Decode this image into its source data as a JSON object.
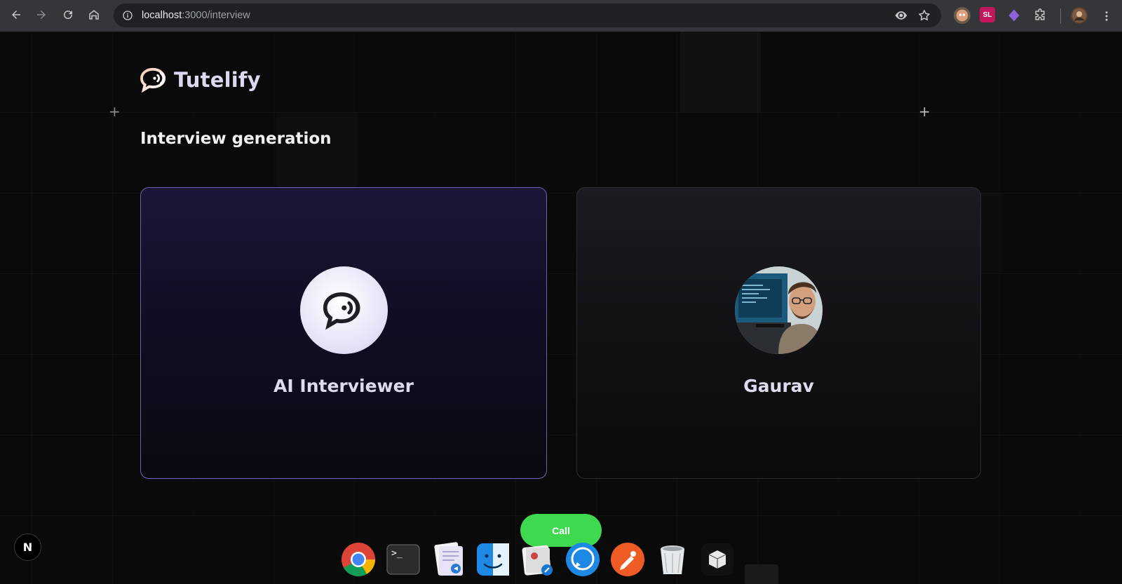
{
  "browser": {
    "url_host": "localhost",
    "url_path": ":3000/interview",
    "ext_sl_label": "SL"
  },
  "app": {
    "brand": "Tutelify",
    "heading": "Interview generation"
  },
  "cards": {
    "ai_label": "AI Interviewer",
    "user_label": "Gaurav"
  },
  "call_button": "Call",
  "next_badge": "N",
  "colors": {
    "accent_purple": "#6c63a8",
    "call_green": "#3fd84f",
    "background": "#0a0a0b"
  },
  "dock": {
    "icons": [
      "chrome-icon",
      "terminal-icon",
      "text-editor-icon",
      "finder-icon",
      "preview-icon",
      "messages-icon",
      "postman-icon",
      "trash-icon",
      "box-app-icon"
    ]
  }
}
